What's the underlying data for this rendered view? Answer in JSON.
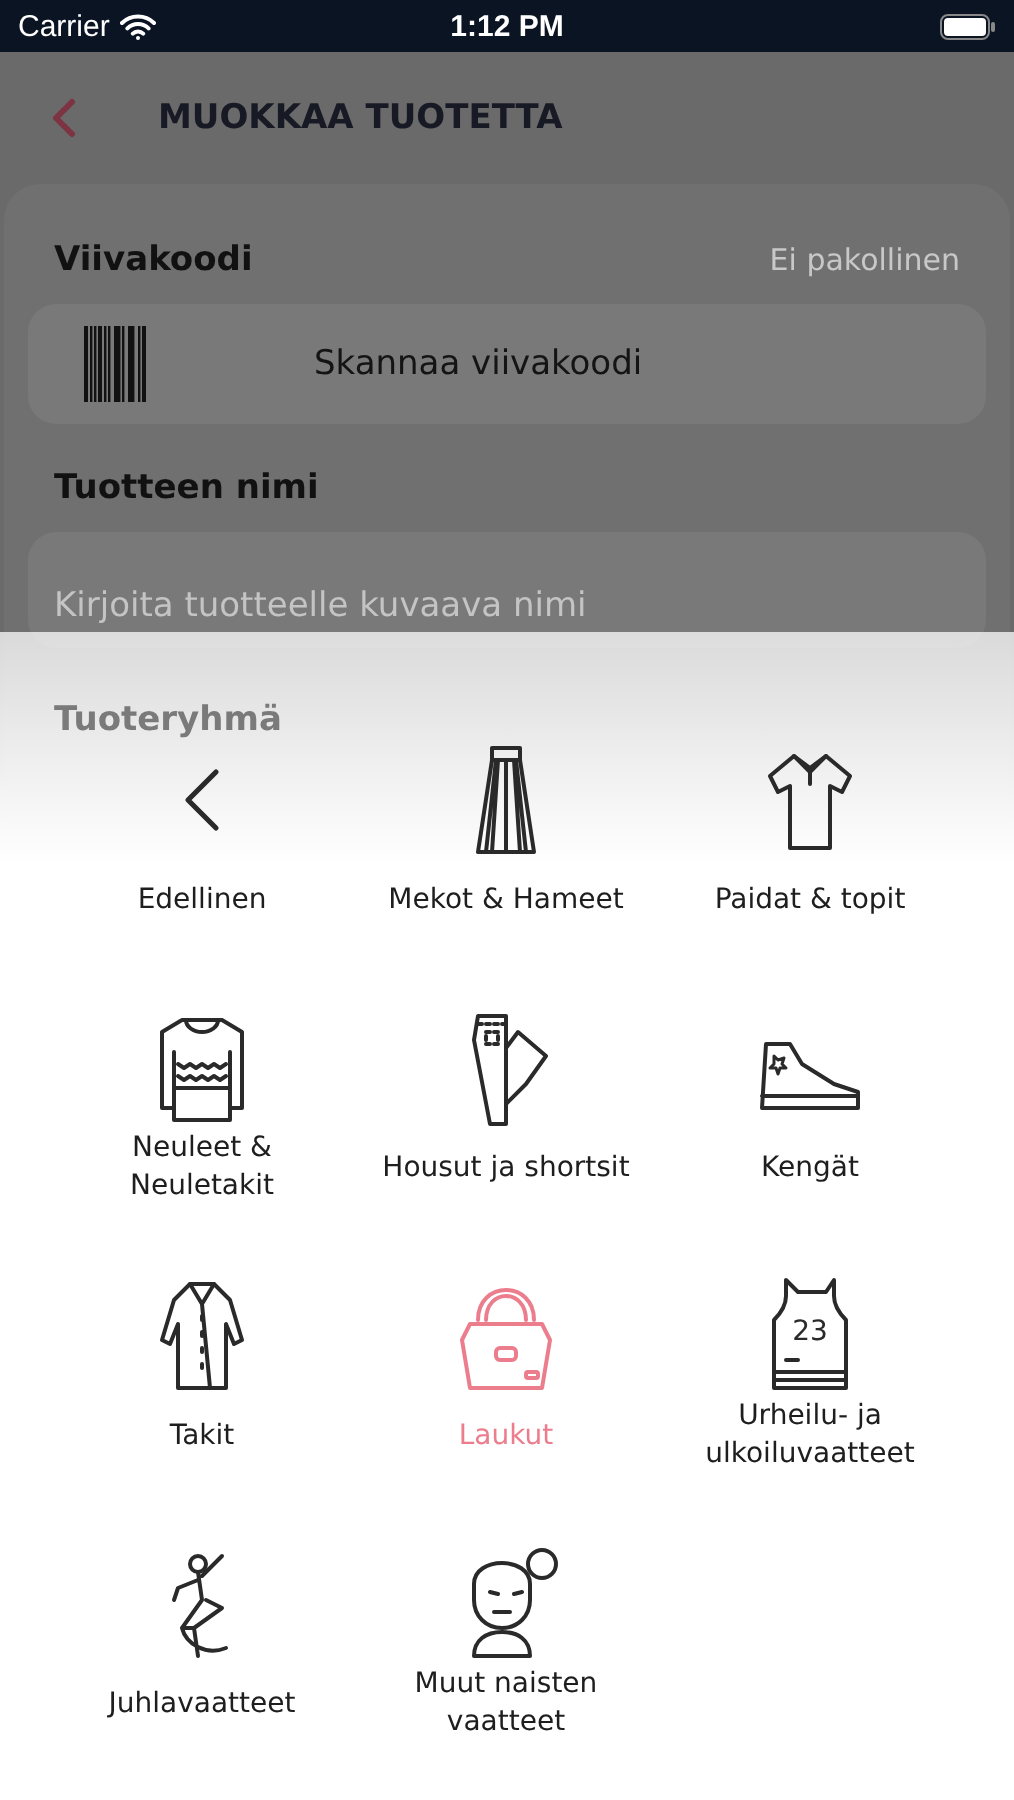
{
  "status_bar": {
    "carrier": "Carrier",
    "time": "1:12 PM"
  },
  "header": {
    "title": "MUOKKAA TUOTETTA"
  },
  "form": {
    "barcode_label": "Viivakoodi",
    "barcode_hint": "Ei pakollinen",
    "barcode_button": "Skannaa viivakoodi",
    "name_label": "Tuotteen nimi",
    "name_placeholder": "Kirjoita tuotteelle kuvaava nimi",
    "group_label": "Tuoteryhmä"
  },
  "categories": [
    {
      "kind": "back",
      "label": "Edellinen",
      "selected": false
    },
    {
      "kind": "skirt",
      "label": "Mekot & Hameet",
      "selected": false
    },
    {
      "kind": "shirt",
      "label": "Paidat & topit",
      "selected": false
    },
    {
      "kind": "sweater",
      "label": "Neuleet & Neuletakit",
      "selected": false
    },
    {
      "kind": "pants",
      "label": "Housut ja shortsit",
      "selected": false
    },
    {
      "kind": "sneaker",
      "label": "Kengät",
      "selected": false
    },
    {
      "kind": "coat",
      "label": "Takit",
      "selected": false
    },
    {
      "kind": "bag",
      "label": "Laukut",
      "selected": true
    },
    {
      "kind": "jersey",
      "label": "Urheilu- ja ulkoiluvaatteet",
      "selected": false,
      "number": "23"
    },
    {
      "kind": "dancer",
      "label": "Juhlavaatteet",
      "selected": false
    },
    {
      "kind": "person",
      "label": "Muut naisten vaatteet",
      "selected": false
    }
  ]
}
